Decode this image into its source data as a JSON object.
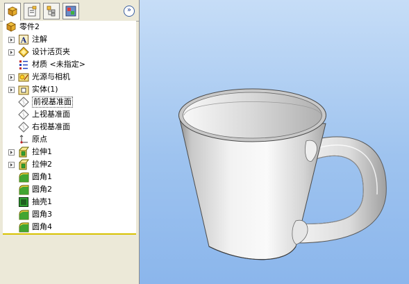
{
  "feature_manager": {
    "tabs": [
      {
        "name": "featuremanager-tab",
        "active": true
      },
      {
        "name": "propertymanager-tab",
        "active": false
      },
      {
        "name": "configurationmanager-tab",
        "active": false
      },
      {
        "name": "dimxpert-tab",
        "active": false
      }
    ],
    "expand_glyph": "»",
    "tree": {
      "root": "零件2",
      "items": [
        {
          "label": "注解",
          "icon": "annotations-icon",
          "expandable": true
        },
        {
          "label": "设计活页夹",
          "icon": "design-binder-icon",
          "expandable": true
        },
        {
          "label": "材质 <未指定>",
          "icon": "material-icon",
          "expandable": false
        },
        {
          "label": "光源与相机",
          "icon": "lights-cameras-icon",
          "expandable": true
        },
        {
          "label": "实体(1)",
          "icon": "solid-bodies-icon",
          "expandable": true
        },
        {
          "label": "前视基准面",
          "icon": "plane-icon",
          "expandable": false,
          "selected": true
        },
        {
          "label": "上视基准面",
          "icon": "plane-icon",
          "expandable": false
        },
        {
          "label": "右视基准面",
          "icon": "plane-icon",
          "expandable": false
        },
        {
          "label": "原点",
          "icon": "origin-icon",
          "expandable": false
        },
        {
          "label": "拉伸1",
          "icon": "extrude-icon",
          "expandable": true
        },
        {
          "label": "拉伸2",
          "icon": "extrude-icon",
          "expandable": true
        },
        {
          "label": "圆角1",
          "icon": "fillet-icon",
          "expandable": false
        },
        {
          "label": "圆角2",
          "icon": "fillet-icon",
          "expandable": false
        },
        {
          "label": "抽壳1",
          "icon": "shell-icon",
          "expandable": false
        },
        {
          "label": "圆角3",
          "icon": "fillet-icon",
          "expandable": false
        },
        {
          "label": "圆角4",
          "icon": "fillet-icon",
          "expandable": false
        }
      ]
    }
  },
  "viewport": {
    "model": "mug-3d-model",
    "background_top": "#c6ddf7",
    "background_bottom": "#8bb6ec"
  }
}
